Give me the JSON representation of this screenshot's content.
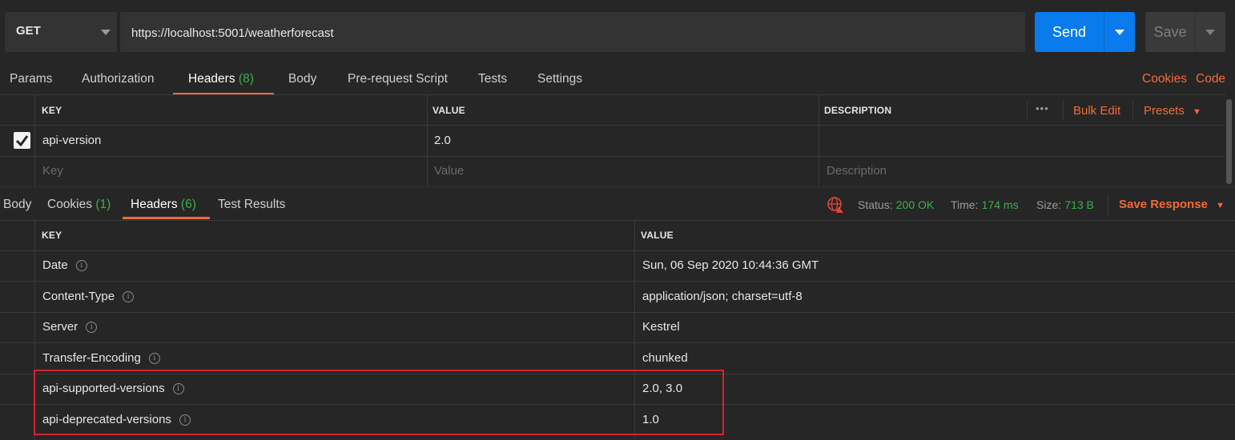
{
  "request": {
    "method": "GET",
    "url": "https://localhost:5001/weatherforecast",
    "send_label": "Send",
    "save_label": "Save"
  },
  "request_tabs": [
    {
      "label": "Params"
    },
    {
      "label": "Authorization"
    },
    {
      "label": "Headers",
      "count": "(8)",
      "active": true
    },
    {
      "label": "Body"
    },
    {
      "label": "Pre-request Script"
    },
    {
      "label": "Tests"
    },
    {
      "label": "Settings"
    }
  ],
  "request_links": {
    "cookies": "Cookies",
    "code": "Code"
  },
  "request_headers_table": {
    "columns": {
      "key": "KEY",
      "value": "VALUE",
      "description": "DESCRIPTION"
    },
    "more_label": "•••",
    "bulk_edit": "Bulk Edit",
    "presets": "Presets",
    "rows": [
      {
        "checked": true,
        "key": "api-version",
        "value": "2.0",
        "description": ""
      }
    ],
    "placeholder": {
      "key": "Key",
      "value": "Value",
      "description": "Description"
    }
  },
  "response_tabs": [
    {
      "label": "Body"
    },
    {
      "label": "Cookies",
      "count": "(1)"
    },
    {
      "label": "Headers",
      "count": "(6)",
      "active": true
    },
    {
      "label": "Test Results"
    }
  ],
  "response_status": {
    "status_label": "Status:",
    "status_value": "200 OK",
    "time_label": "Time:",
    "time_value": "174 ms",
    "size_label": "Size:",
    "size_value": "713 B",
    "save_response": "Save Response"
  },
  "response_headers_table": {
    "columns": {
      "key": "KEY",
      "value": "VALUE"
    },
    "info_glyph": "i",
    "rows": [
      {
        "key": "Date",
        "value": "Sun, 06 Sep 2020 10:44:36 GMT"
      },
      {
        "key": "Content-Type",
        "value": "application/json; charset=utf-8"
      },
      {
        "key": "Server",
        "value": "Kestrel"
      },
      {
        "key": "Transfer-Encoding",
        "value": "chunked"
      },
      {
        "key": "api-supported-versions",
        "value": "2.0, 3.0"
      },
      {
        "key": "api-deprecated-versions",
        "value": "1.0"
      }
    ]
  },
  "colors": {
    "accent": "#f26b3a",
    "send": "#097bed",
    "success": "#3fae4a",
    "highlight": "#d4242c",
    "background": "#262626"
  }
}
